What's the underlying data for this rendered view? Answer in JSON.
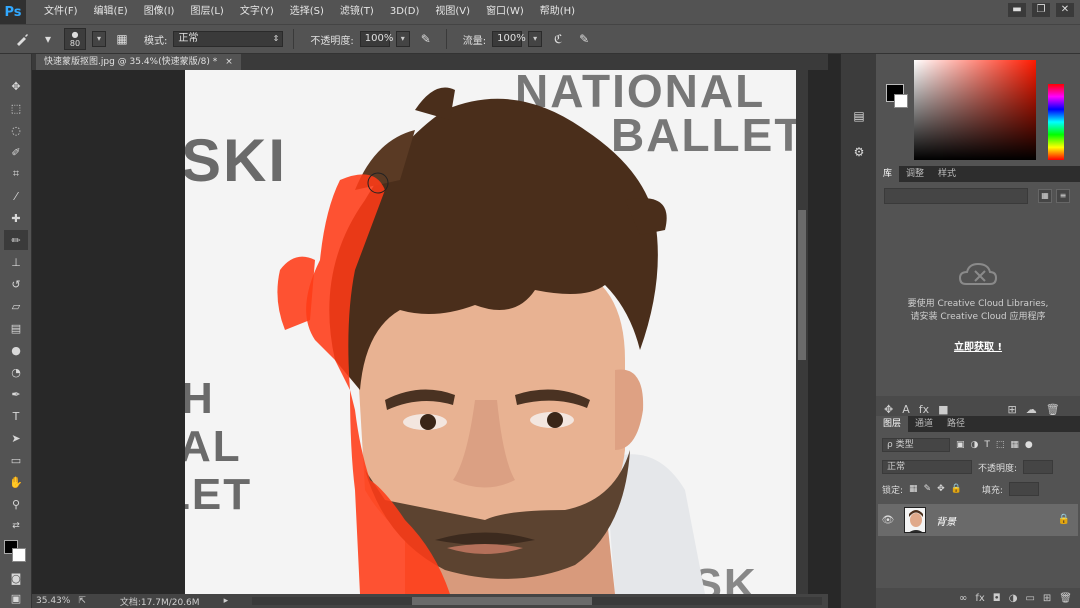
{
  "app": {
    "logo": "Ps"
  },
  "menu": [
    "文件(F)",
    "编辑(E)",
    "图像(I)",
    "图层(L)",
    "文字(Y)",
    "选择(S)",
    "滤镜(T)",
    "3D(D)",
    "视图(V)",
    "窗口(W)",
    "帮助(H)"
  ],
  "window_buttons": [
    "▬",
    "❐",
    "✕"
  ],
  "options": {
    "brush_size": "80",
    "mode_label": "模式:",
    "mode_value": "正常",
    "opacity_label": "不透明度:",
    "opacity_value": "100%",
    "flow_label": "流量:",
    "flow_value": "100%"
  },
  "document": {
    "tab_title": "快速蒙版抠图.jpg @ 35.4%(快速蒙版/8) *",
    "tab_close": "×",
    "bg_text": {
      "ski": "SKI",
      "national": "NATIONAL",
      "ballet": "BALLET",
      "h": "H",
      "al1": "AL",
      "al2": "LET",
      "ovsk": "OVSK"
    }
  },
  "status": {
    "zoom": "35.43%",
    "doc_info": "文档:17.7M/20.6M"
  },
  "panels": {
    "lib_tabs": [
      "库",
      "调整",
      "样式"
    ],
    "lib_message_1": "要使用 Creative Cloud Libraries,",
    "lib_message_2": "请安装 Creative Cloud 应用程序",
    "lib_link": "立即获取 !",
    "layer_tabs": [
      "图层",
      "通道",
      "路径"
    ],
    "filter_type": "ρ 类型",
    "blend_mode": "正常",
    "opacity_label": "不透明度:",
    "lock_label": "锁定:",
    "fill_label": "填充:",
    "layer_name": "背景"
  },
  "colors": {
    "quick_mask": "#ff3b17",
    "ps_blue": "#31a8ff"
  }
}
